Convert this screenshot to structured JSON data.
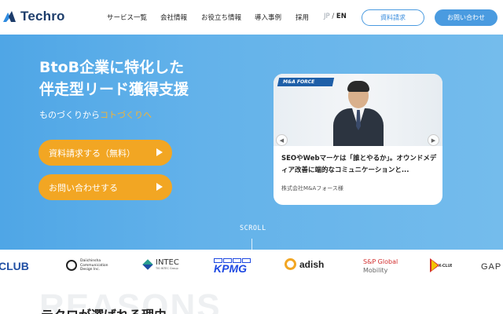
{
  "header": {
    "logo_text": "Techro",
    "nav": [
      "サービス一覧",
      "会社情報",
      "お役立ち情報",
      "導入事例",
      "採用"
    ],
    "lang_jp": "JP",
    "lang_sep": " / ",
    "lang_en": "EN",
    "doc_button": "資料請求",
    "contact_button": "お問い合わせ"
  },
  "hero": {
    "title_line1": "BtoB企業に特化した",
    "title_line2": "伴走型リード獲得支援",
    "sub_plain": "ものづくりから",
    "sub_accent": "コトづくりへ",
    "cta_doc": "資料請求する（無料）",
    "cta_contact": "お問い合わせする",
    "scroll": "SCROLL"
  },
  "card": {
    "brand": "M&A FORCE",
    "text": "SEOやWebマーケは「誰とやるか」。オウンドメディア改善に端的なコミュニケーションと...",
    "company": "株式会社M&Aフォース様"
  },
  "logos": {
    "club": "CLUB",
    "daiichi": "Daiichinsha Communication Design Inc.",
    "intec": "INTEC",
    "intec_sub": "TIS INTEC Group",
    "kpmg": "KPMG",
    "adish": "adish",
    "sp1": "S&P Global",
    "sp2": "Mobility",
    "xclub": "X-CLUB",
    "gap": "GAP"
  },
  "reasons": {
    "bg_text": "REASONS",
    "title": "テクロが選ばれる理由"
  },
  "colors": {
    "brand_blue": "#4a9be0",
    "cta_orange": "#f2a623",
    "accent_orange": "#f5b433"
  }
}
